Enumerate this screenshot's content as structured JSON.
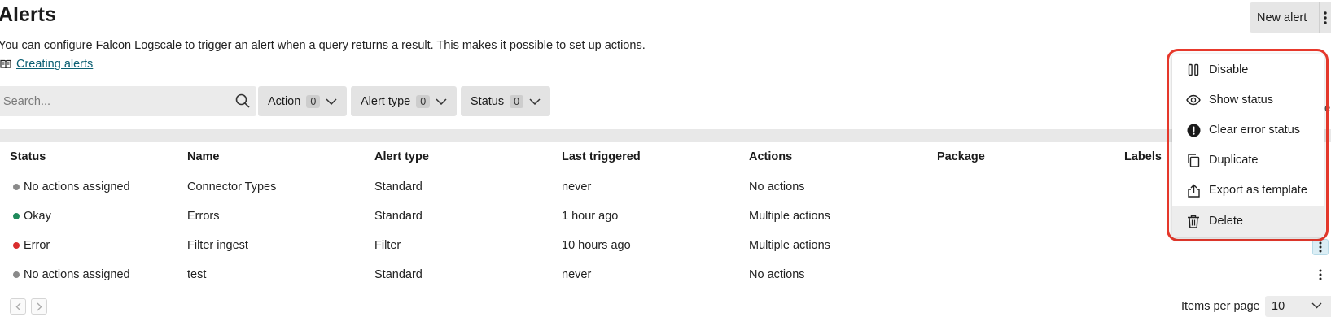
{
  "header": {
    "title": "Alerts",
    "description": "You can configure Falcon Logscale to trigger an alert when a query returns a result. This makes it possible to set up actions.",
    "doc_link": "Creating alerts",
    "new_alert_label": "New alert"
  },
  "search": {
    "placeholder": "Search..."
  },
  "filters": [
    {
      "label": "Action",
      "count": "0"
    },
    {
      "label": "Alert type",
      "count": "0"
    },
    {
      "label": "Status",
      "count": "0"
    }
  ],
  "table": {
    "columns": [
      "Status",
      "Name",
      "Alert type",
      "Last triggered",
      "Actions",
      "Package",
      "Labels"
    ],
    "rows": [
      {
        "status": "No actions assigned",
        "status_color": "#8a8a8a",
        "name": "Connector Types",
        "type": "Standard",
        "last": "never",
        "actions": "No actions",
        "package": "",
        "labels": ""
      },
      {
        "status": "Okay",
        "status_color": "#1f8a5b",
        "name": "Errors",
        "type": "Standard",
        "last": "1 hour ago",
        "actions": "Multiple actions",
        "package": "",
        "labels": ""
      },
      {
        "status": "Error",
        "status_color": "#d92d2d",
        "name": "Filter ingest",
        "type": "Filter",
        "last": "10 hours ago",
        "actions": "Multiple actions",
        "package": "",
        "labels": ""
      },
      {
        "status": "No actions assigned",
        "status_color": "#8a8a8a",
        "name": "test",
        "type": "Standard",
        "last": "never",
        "actions": "No actions",
        "package": "",
        "labels": ""
      }
    ]
  },
  "context_menu": {
    "items": [
      {
        "label": "Disable",
        "icon": "pause-icon"
      },
      {
        "label": "Show status",
        "icon": "eye-icon"
      },
      {
        "label": "Clear error status",
        "icon": "alert-circle-icon"
      },
      {
        "label": "Duplicate",
        "icon": "copy-icon"
      },
      {
        "label": "Export as template",
        "icon": "share-icon"
      },
      {
        "label": "Delete",
        "icon": "trash-icon"
      }
    ],
    "highlight_color": "#e8392c"
  },
  "footer": {
    "items_per_page_label": "Items per page",
    "items_per_page_value": "10"
  },
  "edge_text": "e"
}
